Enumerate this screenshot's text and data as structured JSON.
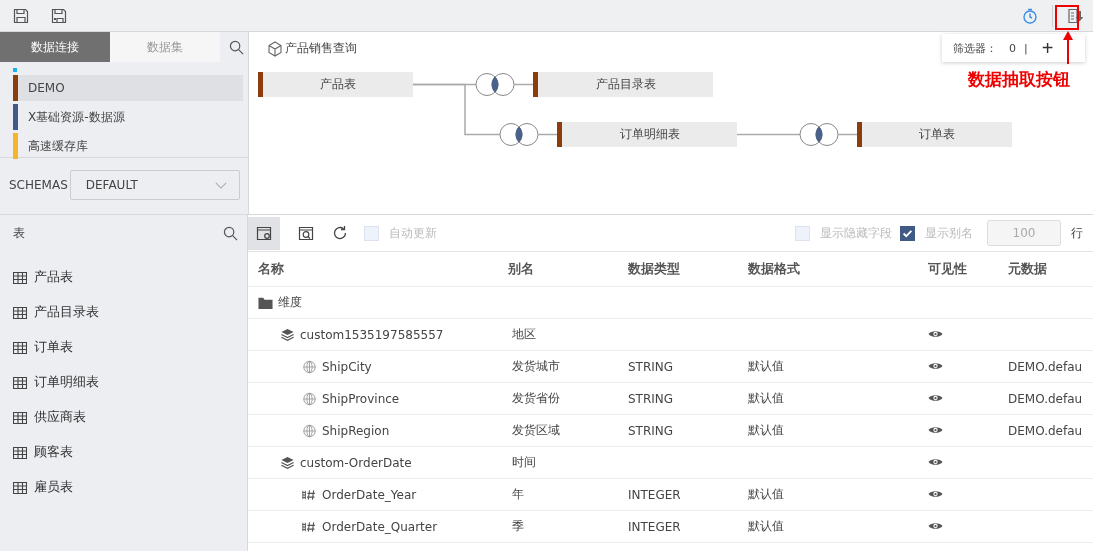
{
  "annotation": {
    "text": "数据抽取按钮"
  },
  "sidebar": {
    "tabs": [
      {
        "label": "数据连接",
        "selected": true
      },
      {
        "label": "数据集",
        "selected": false
      }
    ],
    "connections": [
      {
        "name": "DEMO",
        "color": "#8b3e0b",
        "selected": true
      },
      {
        "name": "X基础资源-数据源",
        "color": "#3f5a84",
        "selected": false
      },
      {
        "name": "高速缓存库",
        "color": "#f6b42a",
        "selected": false
      }
    ],
    "schemas": {
      "label": "SCHEMAS",
      "value": "DEFAULT"
    },
    "tables_header": "表",
    "tables": [
      "产品表",
      "产品目录表",
      "订单表",
      "订单明细表",
      "供应商表",
      "顾客表",
      "雇员表"
    ]
  },
  "query": {
    "title": "产品销售查询",
    "filter": {
      "label": "筛选器：",
      "count": "0",
      "separator": "|",
      "add": "+"
    },
    "nodes": [
      {
        "label": "产品表",
        "children": [
          {
            "label": "产品目录表"
          },
          {
            "label": "订单明细表",
            "children": [
              {
                "label": "订单表"
              }
            ]
          }
        ]
      }
    ]
  },
  "fields_toolbar": {
    "views": [
      {
        "selected": true
      },
      {
        "selected": false
      }
    ],
    "auto_update": {
      "label": "自动更新",
      "checked": false
    },
    "show_hidden": {
      "label": "显示隐藏字段",
      "checked": false
    },
    "show_alias": {
      "label": "显示别名",
      "checked": true
    },
    "rows_value": "100",
    "rows_unit": "行"
  },
  "fields": {
    "columns": [
      "名称",
      "别名",
      "数据类型",
      "数据格式",
      "可见性",
      "元数据"
    ],
    "rows": [
      {
        "kind": "folder",
        "name": "维度",
        "visible": false,
        "children": [
          {
            "kind": "group",
            "name": "custom1535197585557",
            "alias": "地区",
            "visible": true,
            "children": [
              {
                "kind": "geo",
                "name": "ShipCity",
                "alias": "发货城市",
                "type": "STRING",
                "format": "默认值",
                "visible": true,
                "metadata": "DEMO.defau"
              },
              {
                "kind": "geo",
                "name": "ShipProvince",
                "alias": "发货省份",
                "type": "STRING",
                "format": "默认值",
                "visible": true,
                "metadata": "DEMO.defau"
              },
              {
                "kind": "geo",
                "name": "ShipRegion",
                "alias": "发货区域",
                "type": "STRING",
                "format": "默认值",
                "visible": true,
                "metadata": "DEMO.defau"
              }
            ]
          },
          {
            "kind": "group",
            "name": "custom-OrderDate",
            "alias": "时间",
            "visible": true,
            "children": [
              {
                "kind": "number",
                "name": "OrderDate_Year",
                "alias": "年",
                "type": "INTEGER",
                "format": "默认值",
                "visible": true
              },
              {
                "kind": "number",
                "name": "OrderDate_Quarter",
                "alias": "季",
                "type": "INTEGER",
                "format": "默认值",
                "visible": true
              }
            ]
          }
        ]
      }
    ]
  }
}
